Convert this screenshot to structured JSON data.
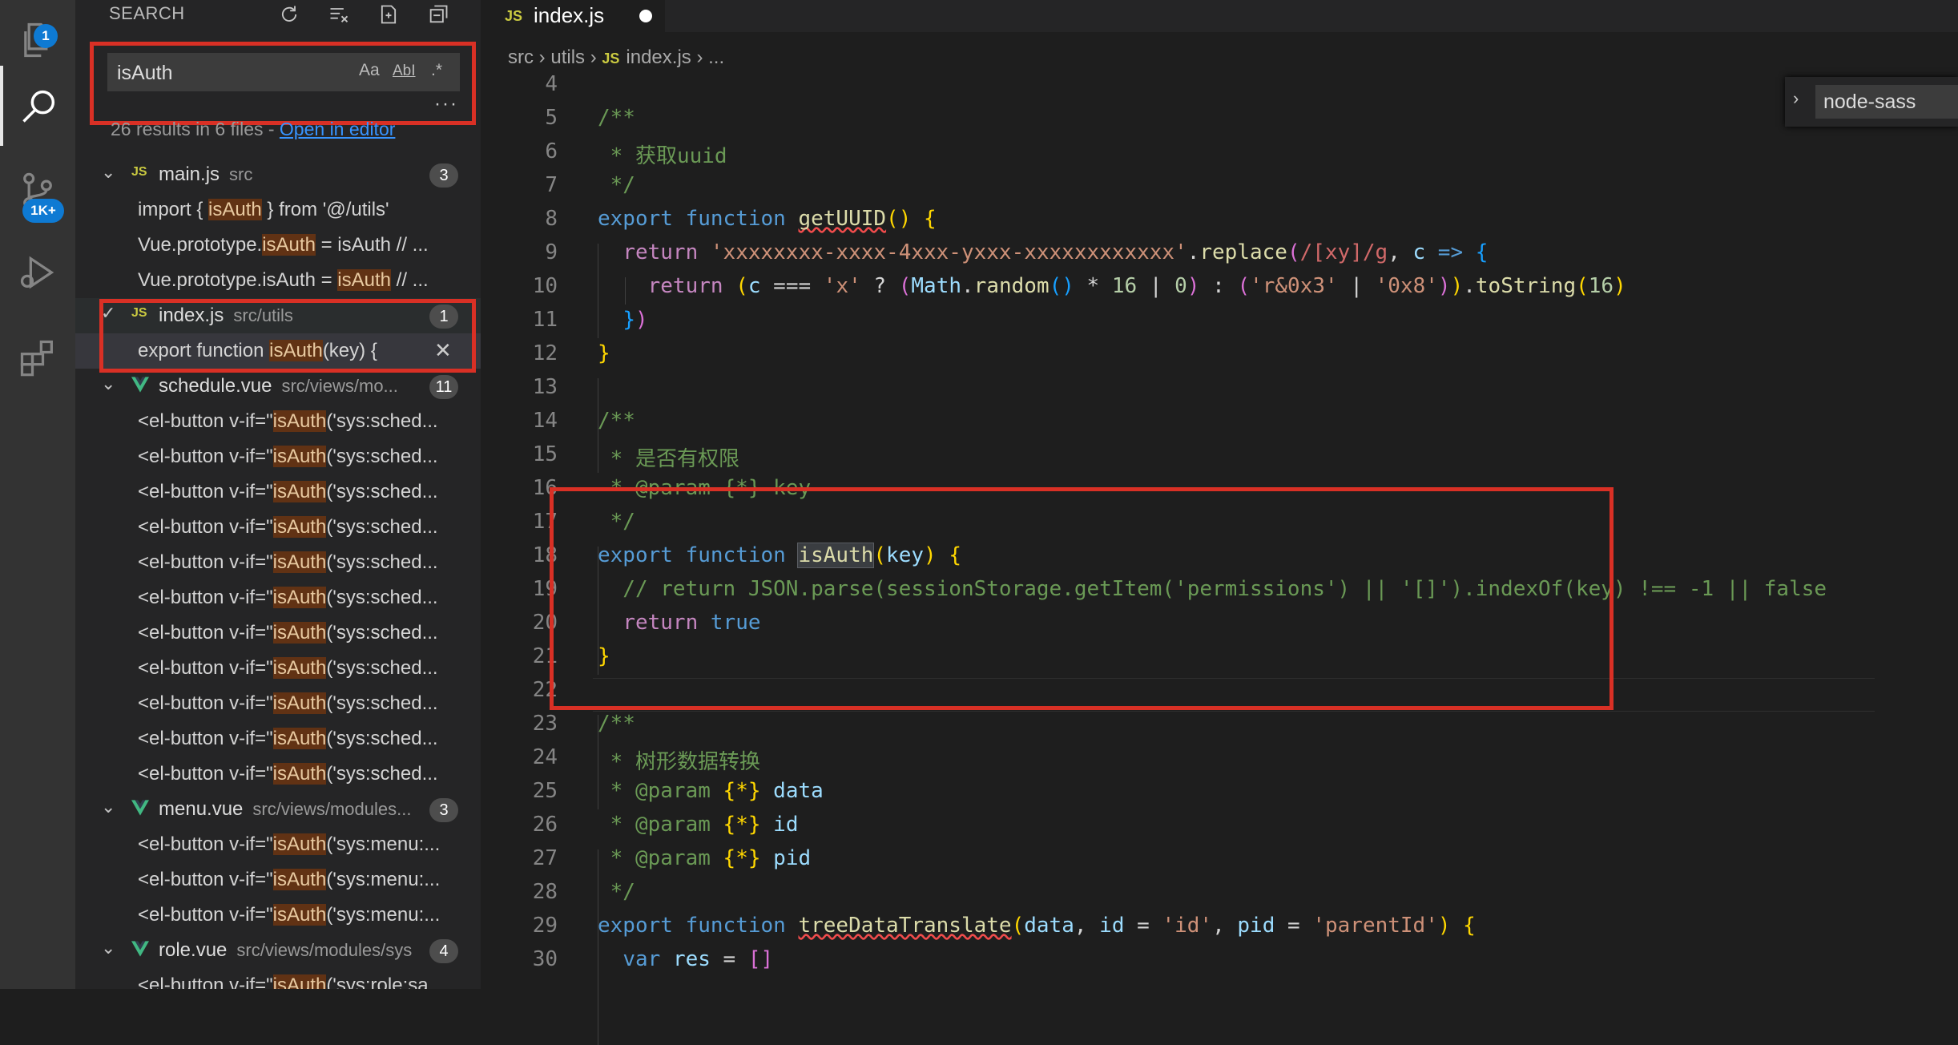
{
  "activity_bar": {
    "explorer_badge": "1",
    "scm_badge": "1K+"
  },
  "sidebar": {
    "title": "SEARCH",
    "search_value": "isAuth",
    "options": {
      "case": "Aa",
      "word": "AbI",
      "regex": ".*"
    },
    "more": "···",
    "summary": "26 results in 6 files - ",
    "open_in_editor": "Open in editor",
    "files": [
      {
        "name": "main.js",
        "path": "src",
        "count": "3",
        "icon": "js-icon",
        "matches": [
          {
            "pre": "import { ",
            "hit": "isAuth",
            "post": " } from '@/utils'"
          },
          {
            "pre": "Vue.prototype.",
            "hit": "isAuth",
            "post": " = isAuth     // ..."
          },
          {
            "pre": "Vue.prototype.isAuth = ",
            "hit": "isAuth",
            "post": "     // ..."
          }
        ]
      },
      {
        "name": "index.js",
        "path": "src/utils",
        "count": "1",
        "icon": "js-icon",
        "matches": [
          {
            "pre": "export function ",
            "hit": "isAuth",
            "post": "(key) {"
          }
        ]
      },
      {
        "name": "schedule.vue",
        "path": "src/views/mo...",
        "count": "11",
        "icon": "vue-icon",
        "matches": [
          {
            "pre": "<el-button v-if=\"",
            "hit": "isAuth",
            "post": "('sys:sched..."
          },
          {
            "pre": "<el-button v-if=\"",
            "hit": "isAuth",
            "post": "('sys:sched..."
          },
          {
            "pre": "<el-button v-if=\"",
            "hit": "isAuth",
            "post": "('sys:sched..."
          },
          {
            "pre": "<el-button v-if=\"",
            "hit": "isAuth",
            "post": "('sys:sched..."
          },
          {
            "pre": "<el-button v-if=\"",
            "hit": "isAuth",
            "post": "('sys:sched..."
          },
          {
            "pre": "<el-button v-if=\"",
            "hit": "isAuth",
            "post": "('sys:sched..."
          },
          {
            "pre": "<el-button v-if=\"",
            "hit": "isAuth",
            "post": "('sys:sched..."
          },
          {
            "pre": "<el-button v-if=\"",
            "hit": "isAuth",
            "post": "('sys:sched..."
          },
          {
            "pre": "<el-button v-if=\"",
            "hit": "isAuth",
            "post": "('sys:sched..."
          },
          {
            "pre": "<el-button v-if=\"",
            "hit": "isAuth",
            "post": "('sys:sched..."
          },
          {
            "pre": "<el-button v-if=\"",
            "hit": "isAuth",
            "post": "('sys:sched..."
          }
        ]
      },
      {
        "name": "menu.vue",
        "path": "src/views/modules...",
        "count": "3",
        "icon": "vue-icon",
        "matches": [
          {
            "pre": "<el-button v-if=\"",
            "hit": "isAuth",
            "post": "('sys:menu:..."
          },
          {
            "pre": "<el-button v-if=\"",
            "hit": "isAuth",
            "post": "('sys:menu:..."
          },
          {
            "pre": "<el-button v-if=\"",
            "hit": "isAuth",
            "post": "('sys:menu:..."
          }
        ]
      },
      {
        "name": "role.vue",
        "path": "src/views/modules/sys",
        "count": "4",
        "icon": "vue-icon",
        "matches": [
          {
            "pre": "<el-button v-if=\"",
            "hit": "isAuth",
            "post": "('sys:role:sa..."
          }
        ]
      }
    ]
  },
  "editor": {
    "tab": {
      "label": "index.js",
      "icon_text": "JS"
    },
    "breadcrumb": [
      "src",
      "utils",
      "index.js",
      "..."
    ],
    "find_widget_value": "node-sass",
    "lines": [
      {
        "n": "4",
        "t": []
      },
      {
        "n": "5",
        "t": [
          [
            "c",
            "/**"
          ]
        ]
      },
      {
        "n": "6",
        "t": [
          [
            "c",
            " * 获取uuid"
          ]
        ]
      },
      {
        "n": "7",
        "t": [
          [
            "c",
            " */"
          ]
        ]
      },
      {
        "n": "8",
        "t": [
          [
            "k",
            "export "
          ],
          [
            "k",
            "function "
          ],
          [
            "f sq",
            "getUUID"
          ],
          [
            "b1",
            "() {"
          ]
        ]
      },
      {
        "n": "9",
        "t": [
          [
            "",
            "  "
          ],
          [
            "ck",
            "return "
          ],
          [
            "s",
            "'xxxxxxxx-xxxx-4xxx-yxxx-xxxxxxxxxxxx'"
          ],
          [
            "",
            "."
          ],
          [
            "f",
            "replace"
          ],
          [
            "b2",
            "("
          ],
          [
            "re",
            "/[xy]/g"
          ],
          [
            "",
            ", "
          ],
          [
            "p",
            "c"
          ],
          [
            "k",
            " => "
          ],
          [
            "b3",
            "{"
          ]
        ]
      },
      {
        "n": "10",
        "t": [
          [
            "",
            "    "
          ],
          [
            "ck",
            "return "
          ],
          [
            "b1",
            "("
          ],
          [
            "p",
            "c"
          ],
          [
            "",
            " === "
          ],
          [
            "s",
            "'x'"
          ],
          [
            "",
            " ? "
          ],
          [
            "b2",
            "("
          ],
          [
            "p",
            "Math"
          ],
          [
            "",
            "."
          ],
          [
            "f",
            "random"
          ],
          [
            "b3",
            "()"
          ],
          [
            "",
            " * "
          ],
          [
            "n",
            "16"
          ],
          [
            "",
            " | "
          ],
          [
            "n",
            "0"
          ],
          [
            "b2",
            ")"
          ],
          [
            "",
            " : "
          ],
          [
            "b2",
            "("
          ],
          [
            "s",
            "'r&0x3'"
          ],
          [
            "",
            " | "
          ],
          [
            "s",
            "'0x8'"
          ],
          [
            "b2",
            ")"
          ],
          [
            "b1",
            ")"
          ],
          [
            "",
            "."
          ],
          [
            "f",
            "toString"
          ],
          [
            "b1",
            "("
          ],
          [
            "n",
            "16"
          ],
          [
            "b1",
            ")"
          ]
        ]
      },
      {
        "n": "11",
        "t": [
          [
            "",
            "  "
          ],
          [
            "b3",
            "}"
          ],
          [
            "b2",
            ")"
          ]
        ]
      },
      {
        "n": "12",
        "t": [
          [
            "b1",
            "}"
          ]
        ]
      },
      {
        "n": "13",
        "t": []
      },
      {
        "n": "14",
        "t": [
          [
            "c",
            "/**"
          ]
        ]
      },
      {
        "n": "15",
        "t": [
          [
            "c",
            " * 是否有权限"
          ]
        ]
      },
      {
        "n": "16",
        "t": [
          [
            "c",
            " * @param {*} key"
          ]
        ]
      },
      {
        "n": "17",
        "t": [
          [
            "c",
            " */"
          ]
        ]
      },
      {
        "n": "18",
        "t": [
          [
            "k",
            "export "
          ],
          [
            "k",
            "function "
          ],
          [
            "f wordhl",
            "isAuth"
          ],
          [
            "b1",
            "("
          ],
          [
            "p",
            "key"
          ],
          [
            "b1",
            ") {"
          ]
        ]
      },
      {
        "n": "19",
        "t": [
          [
            "c",
            "  // return JSON.parse(sessionStorage.getItem('permissions') || '[]').indexOf(key) !== -1 || false"
          ]
        ]
      },
      {
        "n": "20",
        "t": [
          [
            "",
            "  "
          ],
          [
            "ck",
            "return "
          ],
          [
            "k",
            "true"
          ]
        ]
      },
      {
        "n": "21",
        "t": [
          [
            "b1",
            "}"
          ]
        ]
      },
      {
        "n": "22",
        "t": []
      },
      {
        "n": "23",
        "t": [
          [
            "c",
            "/**"
          ]
        ]
      },
      {
        "n": "24",
        "t": [
          [
            "c",
            " * 树形数据转换"
          ]
        ]
      },
      {
        "n": "25",
        "t": [
          [
            "c",
            " * @param "
          ],
          [
            "b1",
            "{*}"
          ],
          [
            "p",
            " data"
          ]
        ]
      },
      {
        "n": "26",
        "t": [
          [
            "c",
            " * @param "
          ],
          [
            "b1",
            "{*}"
          ],
          [
            "p",
            " id"
          ]
        ]
      },
      {
        "n": "27",
        "t": [
          [
            "c",
            " * @param "
          ],
          [
            "b1",
            "{*}"
          ],
          [
            "p",
            " pid"
          ]
        ]
      },
      {
        "n": "28",
        "t": [
          [
            "c",
            " */"
          ]
        ]
      },
      {
        "n": "29",
        "t": [
          [
            "k",
            "export "
          ],
          [
            "k",
            "function "
          ],
          [
            "f sq",
            "treeDataTranslate"
          ],
          [
            "b1",
            "("
          ],
          [
            "p",
            "data"
          ],
          [
            "",
            ", "
          ],
          [
            "p",
            "id"
          ],
          [
            "",
            " = "
          ],
          [
            "s",
            "'id'"
          ],
          [
            "",
            ", "
          ],
          [
            "p",
            "pid"
          ],
          [
            "",
            " = "
          ],
          [
            "s",
            "'parentId'"
          ],
          [
            "b1",
            ") {"
          ]
        ]
      },
      {
        "n": "30",
        "t": [
          [
            "",
            "  "
          ],
          [
            "k",
            "var "
          ],
          [
            "p",
            "res"
          ],
          [
            "",
            " = "
          ],
          [
            "b2",
            "[]"
          ]
        ]
      }
    ]
  },
  "colors": {
    "highlight_box": "#d93025",
    "match_highlight": "#613214",
    "badge_blue": "#0e7ad3"
  }
}
